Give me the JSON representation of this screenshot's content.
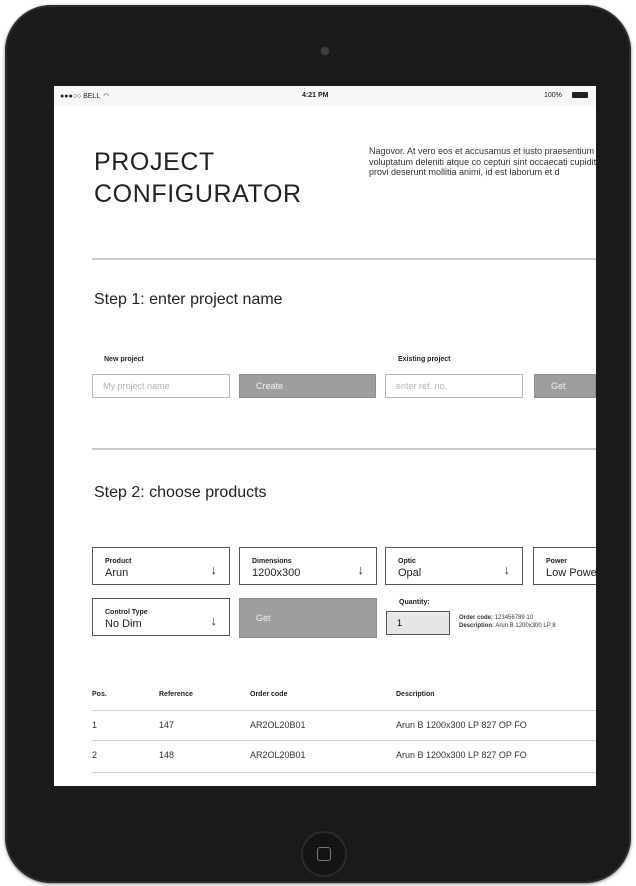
{
  "status_bar": {
    "carrier": "BELL",
    "time": "4:21 PM",
    "battery": "100%"
  },
  "header": {
    "title_line1": "PROJECT",
    "title_line2": "CONFIGURATOR",
    "intro": "Nagovor. At vero eos et accusamus et iusto praesentium voluptatum deleniti atque co cepturi sint occaecati cupiditate non provi deserunt mollitia animi, id est laborum et d"
  },
  "step1": {
    "heading": "Step 1: enter project name",
    "new_project": {
      "label": "New project",
      "placeholder": "My project name",
      "button": "Create"
    },
    "existing_project": {
      "label": "Existing project",
      "placeholder": "enter ref. no.",
      "button": "Get"
    }
  },
  "step2": {
    "heading": "Step 2: choose products",
    "product": {
      "label": "Product",
      "value": "Arun"
    },
    "dimensions": {
      "label": "Dimensions",
      "value": "1200x300"
    },
    "optic": {
      "label": "Optic",
      "value": "Opal"
    },
    "power": {
      "label": "Power",
      "value": "Low Power"
    },
    "control_type": {
      "label": "Control Type",
      "value": "No Dim"
    },
    "get_button": "Get",
    "quantity": {
      "label": "Quantity:",
      "value": "1"
    },
    "order_code_label": "Order code:",
    "order_code_value": "123456789 10",
    "description_label": "Description:",
    "description_value": "Arun B 1200x300 LP 8"
  },
  "table": {
    "headers": [
      "Pos.",
      "Reference",
      "Order code",
      "Description"
    ],
    "rows": [
      [
        "1",
        "147",
        "AR2OL20B01",
        "Arun B 1200x300 LP 827 OP FO"
      ],
      [
        "2",
        "148",
        "AR2OL20B01",
        "Arun B 1200x300 LP 827 OP FO"
      ]
    ]
  }
}
